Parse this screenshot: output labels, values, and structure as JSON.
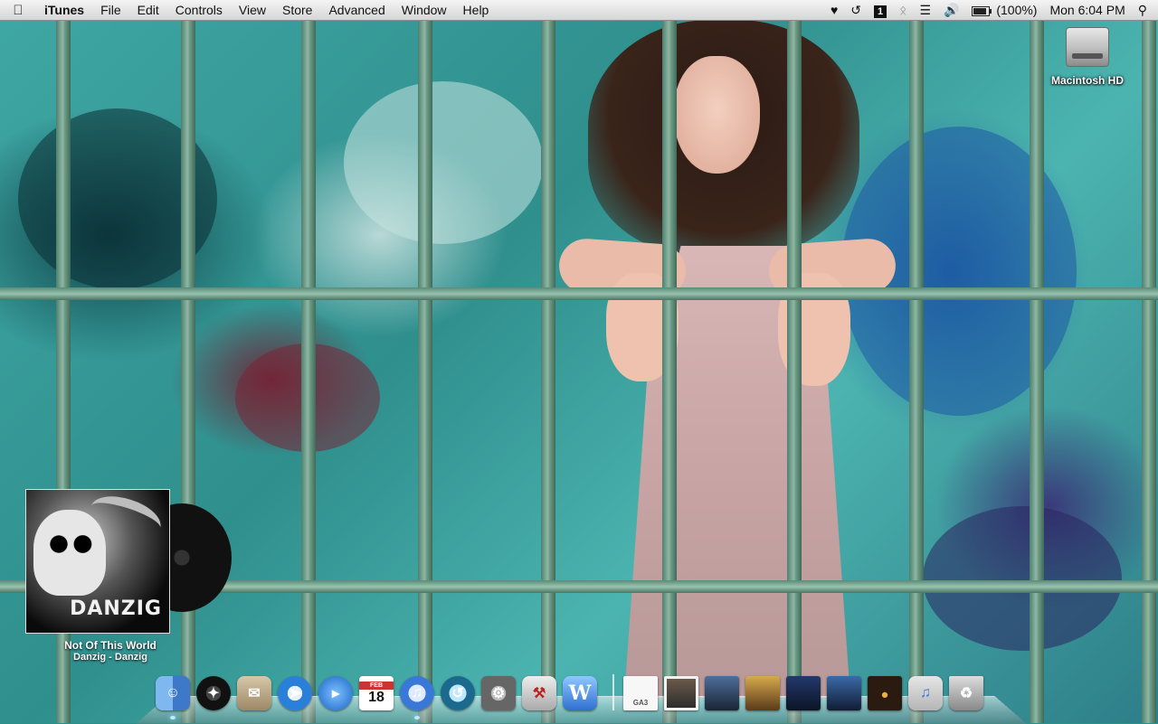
{
  "menubar": {
    "apple_icon": "apple-icon",
    "app_name": "iTunes",
    "menus": [
      "File",
      "Edit",
      "Controls",
      "View",
      "Store",
      "Advanced",
      "Window",
      "Help"
    ],
    "status": {
      "battery_percent": "(100%)",
      "clock": "Mon 6:04 PM",
      "icons": [
        "heart-icon",
        "time-machine-icon",
        "stats-icon",
        "bluetooth-icon",
        "wifi-icon",
        "volume-icon",
        "battery-icon",
        "spotlight-icon"
      ]
    }
  },
  "desktop": {
    "hard_drive": {
      "label": "Macintosh HD",
      "icon": "hard-drive-icon"
    }
  },
  "now_playing": {
    "cover_text": "DANZIG",
    "track": "Not Of This World",
    "artist_album": "Danzig - Danzig"
  },
  "dock": {
    "apps": [
      {
        "name": "Finder",
        "icon": "finder-icon",
        "running": true
      },
      {
        "name": "Dashboard",
        "icon": "dashboard-icon",
        "running": false
      },
      {
        "name": "Mail",
        "icon": "mail-icon",
        "running": false
      },
      {
        "name": "Safari",
        "icon": "safari-icon",
        "running": false
      },
      {
        "name": "iChat",
        "icon": "ichat-icon",
        "running": false
      },
      {
        "name": "iCal",
        "icon": "calendar-icon",
        "running": false,
        "month": "FEB",
        "day": "18"
      },
      {
        "name": "iTunes",
        "icon": "itunes-icon",
        "running": true
      },
      {
        "name": "Time Machine",
        "icon": "time-machine-icon",
        "running": false
      },
      {
        "name": "System Preferences",
        "icon": "system-preferences-icon",
        "running": false
      },
      {
        "name": "Xcode",
        "icon": "xcode-icon",
        "running": false
      },
      {
        "name": "Word",
        "icon": "word-icon",
        "running": false
      }
    ],
    "doc_label": "GA3",
    "accent_color": "#bfe9ff"
  }
}
